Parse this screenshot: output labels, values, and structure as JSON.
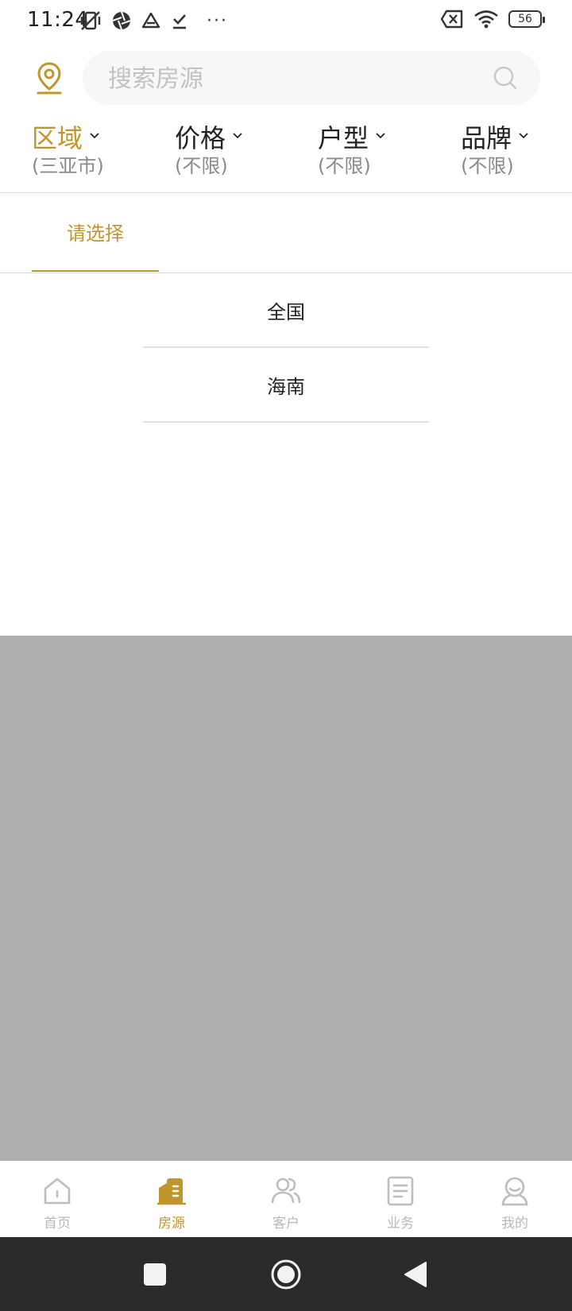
{
  "status_bar": {
    "time": "11:24",
    "more": "···",
    "battery": "56"
  },
  "search": {
    "placeholder": "搜索房源"
  },
  "filters": [
    {
      "label": "区域",
      "sub": "(三亚市)",
      "active": true
    },
    {
      "label": "价格",
      "sub": "(不限)",
      "active": false
    },
    {
      "label": "户型",
      "sub": "(不限)",
      "active": false
    },
    {
      "label": "品牌",
      "sub": "(不限)",
      "active": false
    }
  ],
  "panel": {
    "tab_label": "请选择",
    "regions": [
      "全国",
      "海南"
    ]
  },
  "bottom_nav": [
    {
      "label": "首页",
      "icon": "home-icon",
      "active": false
    },
    {
      "label": "房源",
      "icon": "building-icon",
      "active": true
    },
    {
      "label": "客户",
      "icon": "customers-icon",
      "active": false
    },
    {
      "label": "业务",
      "icon": "document-icon",
      "active": false
    },
    {
      "label": "我的",
      "icon": "profile-icon",
      "active": false
    }
  ],
  "colors": {
    "accent": "#c0962c",
    "overlay": "#afafaf",
    "system_nav": "#2b2b2b"
  }
}
